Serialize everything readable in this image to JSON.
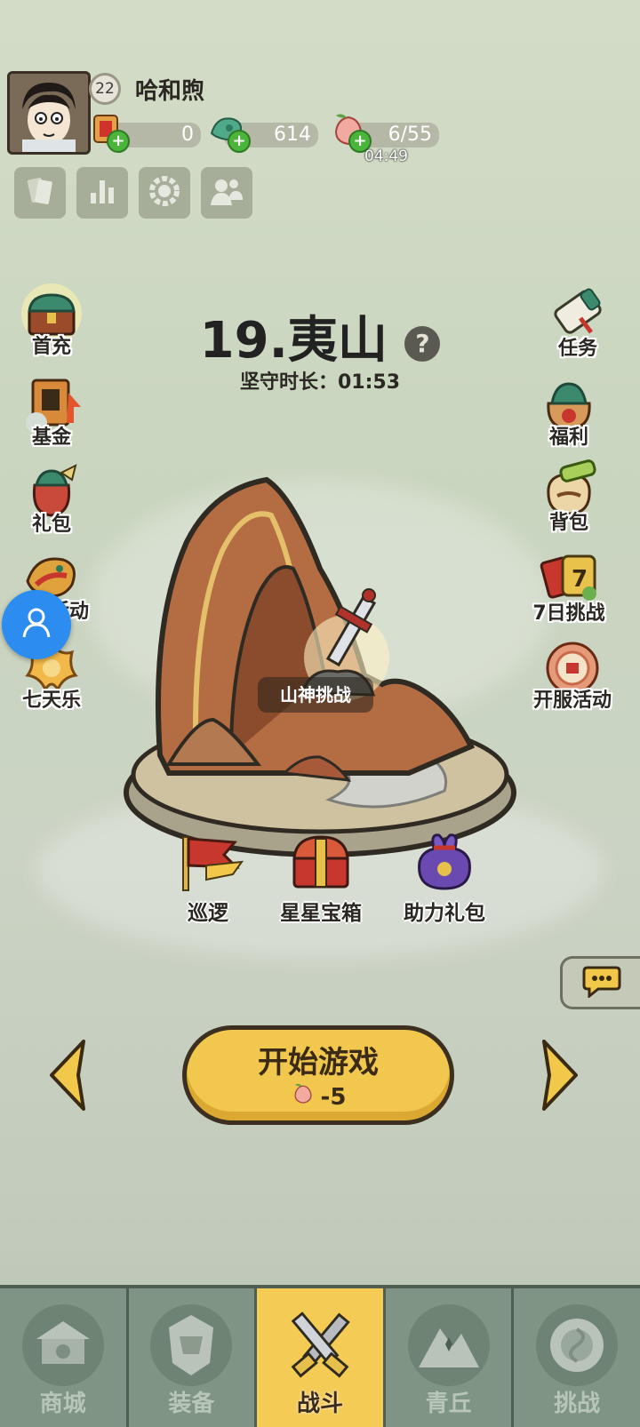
{
  "player": {
    "level": "22",
    "name": "哈和煦"
  },
  "resources": {
    "tickets": "0",
    "jade": "614",
    "stamina": "6/55",
    "stamina_timer": "04:49"
  },
  "toolbar": [
    "cards-icon",
    "rank-icon",
    "settings-icon",
    "friends-icon"
  ],
  "left_menu": [
    {
      "label": "首充",
      "icon": "treasure-chest-icon"
    },
    {
      "label": "基金",
      "icon": "fund-book-icon"
    },
    {
      "label": "礼包",
      "icon": "gift-bag-icon"
    },
    {
      "label": "活动",
      "icon": "event-dragon-icon"
    },
    {
      "label": "七天乐",
      "icon": "seven-day-icon"
    }
  ],
  "right_menu": [
    {
      "label": "任务",
      "icon": "scroll-icon"
    },
    {
      "label": "福利",
      "icon": "welfare-bag-icon"
    },
    {
      "label": "背包",
      "icon": "backpack-icon"
    },
    {
      "label": "7日挑战",
      "icon": "seven-day-challenge-icon"
    },
    {
      "label": "开服活动",
      "icon": "server-event-icon"
    }
  ],
  "stage": {
    "title": "19.夷山",
    "guard_time": "坚守时长：01:53",
    "challenge_label": "山神挑战"
  },
  "stage_actions": [
    {
      "label": "巡逻",
      "icon": "patrol-flag-icon"
    },
    {
      "label": "星星宝箱",
      "icon": "star-chest-icon"
    },
    {
      "label": "助力礼包",
      "icon": "support-pouch-icon"
    }
  ],
  "start": {
    "label": "开始游戏",
    "cost": "-5"
  },
  "nav": [
    {
      "label": "商城",
      "icon": "shop-icon",
      "active": false
    },
    {
      "label": "装备",
      "icon": "armor-icon",
      "active": false
    },
    {
      "label": "战斗",
      "icon": "crossed-swords-icon",
      "active": true
    },
    {
      "label": "青丘",
      "icon": "mountain-icon",
      "active": false
    },
    {
      "label": "挑战",
      "icon": "challenge-disc-icon",
      "active": false
    }
  ],
  "colors": {
    "accent": "#f1c84d",
    "nav_bg": "#7f9484",
    "plus_green": "#4bb43a"
  }
}
